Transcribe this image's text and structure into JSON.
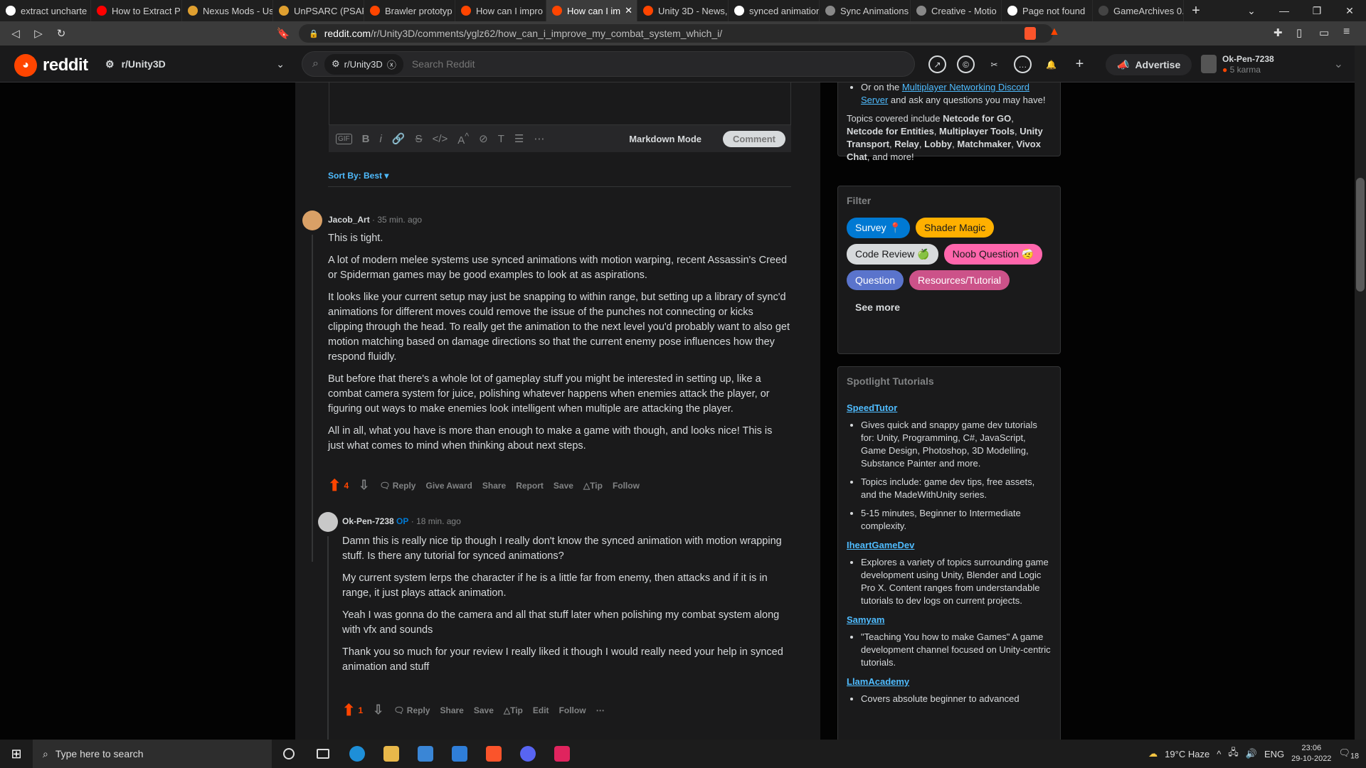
{
  "browser": {
    "tabs": [
      {
        "label": "extract uncharte",
        "fav": "#ffffff"
      },
      {
        "label": "How to Extract P",
        "fav": "#ff0000"
      },
      {
        "label": "Nexus Mods - Us",
        "fav": "#e0a030"
      },
      {
        "label": "UnPSARC (PSARC",
        "fav": "#e0a030"
      },
      {
        "label": "Brawler prototyp",
        "fav": "#ff4500"
      },
      {
        "label": "How can I impro",
        "fav": "#ff4500"
      },
      {
        "label": "How can I im",
        "fav": "#ff4500"
      },
      {
        "label": "Unity 3D - News,",
        "fav": "#ff4500"
      },
      {
        "label": "synced animation",
        "fav": "#ffffff"
      },
      {
        "label": "Sync Animations",
        "fav": "#888888"
      },
      {
        "label": "Creative - Motio",
        "fav": "#888888"
      },
      {
        "label": "Page not found",
        "fav": "#ffffff"
      },
      {
        "label": "GameArchives 0.",
        "fav": "#444444"
      }
    ],
    "url_host": "reddit.com",
    "url_path": "/r/Unity3D/comments/yglz62/how_can_i_improve_my_combat_system_which_i/"
  },
  "header": {
    "logo_text": "reddit",
    "community": "r/Unity3D",
    "search_chip": "r/Unity3D",
    "search_placeholder": "Search Reddit",
    "advertise": "Advertise",
    "username": "Ok-Pen-7238",
    "karma": "5 karma"
  },
  "editor": {
    "markdown_mode": "Markdown Mode",
    "comment_button": "Comment"
  },
  "sort_label": "Sort By: Best",
  "comments": [
    {
      "author": "Jacob_Art",
      "op": "",
      "time": "35 min. ago",
      "paragraphs": [
        "This is tight.",
        "A lot of modern melee systems use synced animations with motion warping, recent Assassin's Creed or Spiderman games may be good examples to look at as aspirations.",
        "It looks like your current setup may just be snapping to within range, but setting up a library of sync'd animations for different moves could remove the issue of the punches not connecting or kicks clipping through the head. To really get the animation to the next level you'd probably want to also get motion matching based on damage directions so that the current enemy pose influences how they respond fluidly.",
        "But before that there's a whole lot of gameplay stuff you might be interested in setting up, like a combat camera system for juice, polishing whatever happens when enemies attack the player, or figuring out ways to make enemies look intelligent when multiple are attacking the player.",
        "All in all, what you have is more than enough to make a game with though, and looks nice! This is just what comes to mind when thinking about next steps."
      ],
      "votes": "4",
      "actions": [
        "Reply",
        "Give Award",
        "Share",
        "Report",
        "Save",
        "Tip",
        "Follow"
      ]
    },
    {
      "author": "Ok-Pen-7238",
      "op": "OP",
      "time": "18 min. ago",
      "paragraphs": [
        "Damn this is really nice tip though I really don't know the synced animation with motion wrapping stuff. Is there any tutorial for synced animations?",
        "My current system lerps the character if he is a little far from enemy, then attacks and if it is in range, it just plays attack animation.",
        "Yeah I was gonna do the camera and all that stuff later when polishing my combat system along with vfx and sounds",
        "Thank you so much for your review I really liked it though I would really need your help in synced animation and stuff"
      ],
      "votes": "1",
      "actions": [
        "Reply",
        "Share",
        "Save",
        "Tip",
        "Edit",
        "Follow"
      ]
    }
  ],
  "sidebar": {
    "top_bullet_prefix": "Or on the ",
    "top_bullet_link": "Multiplayer Networking Discord Server",
    "top_bullet_suffix": " and ask any questions you may have!",
    "topics_prefix": "Topics covered include ",
    "topics_items": [
      "Netcode for GO",
      "Netcode for Entities",
      "Multiplayer Tools",
      "Unity Transport",
      "Relay",
      "Lobby",
      "Matchmaker",
      "Vivox Chat"
    ],
    "topics_suffix": ", and more!",
    "filter_title": "Filter",
    "flairs": [
      {
        "label": "Survey 📍",
        "color": "#0079d3",
        "text": "#ffffff"
      },
      {
        "label": "Shader Magic",
        "color": "#ffb000",
        "text": "#1a1a1b"
      },
      {
        "label": "Code Review 🍏",
        "color": "#d7dadc",
        "text": "#1a1a1b"
      },
      {
        "label": "Noob Question 🤕",
        "color": "#ff66ac",
        "text": "#1a1a1b"
      },
      {
        "label": "Question",
        "color": "#5a74cc",
        "text": "#ffffff"
      },
      {
        "label": "Resources/Tutorial",
        "color": "#cc5289",
        "text": "#ffffff"
      }
    ],
    "see_more": "See more",
    "spotlight_title": "Spotlight Tutorials",
    "tutorials": [
      {
        "name": "SpeedTutor",
        "bullets": [
          "Gives quick and snappy game dev tutorials for: Unity, Programming, C#, JavaScript, Game Design, Photoshop, 3D Modelling, Substance Painter and more.",
          "Topics include: game dev tips, free assets, and the MadeWithUnity series.",
          "5-15 minutes, Beginner to Intermediate complexity."
        ]
      },
      {
        "name": "IheartGameDev",
        "bullets": [
          "Explores a variety of topics surrounding game development using Unity, Blender and Logic Pro X. Content ranges from understandable tutorials to dev logs on current projects."
        ]
      },
      {
        "name": "Samyam",
        "bullets": [
          "\"Teaching You how to make Games\" A game development channel focused on Unity-centric tutorials."
        ]
      },
      {
        "name": "LlamAcademy",
        "bullets": [
          "Covers absolute beginner to advanced"
        ]
      }
    ]
  },
  "taskbar": {
    "search_placeholder": "Type here to search",
    "weather": "19°C  Haze",
    "lang": "ENG",
    "time": "23:06",
    "date": "29-10-2022",
    "notif": "18"
  },
  "colors": {
    "accent": "#ff4500",
    "link": "#4fbcff",
    "op": "#0079d3"
  }
}
